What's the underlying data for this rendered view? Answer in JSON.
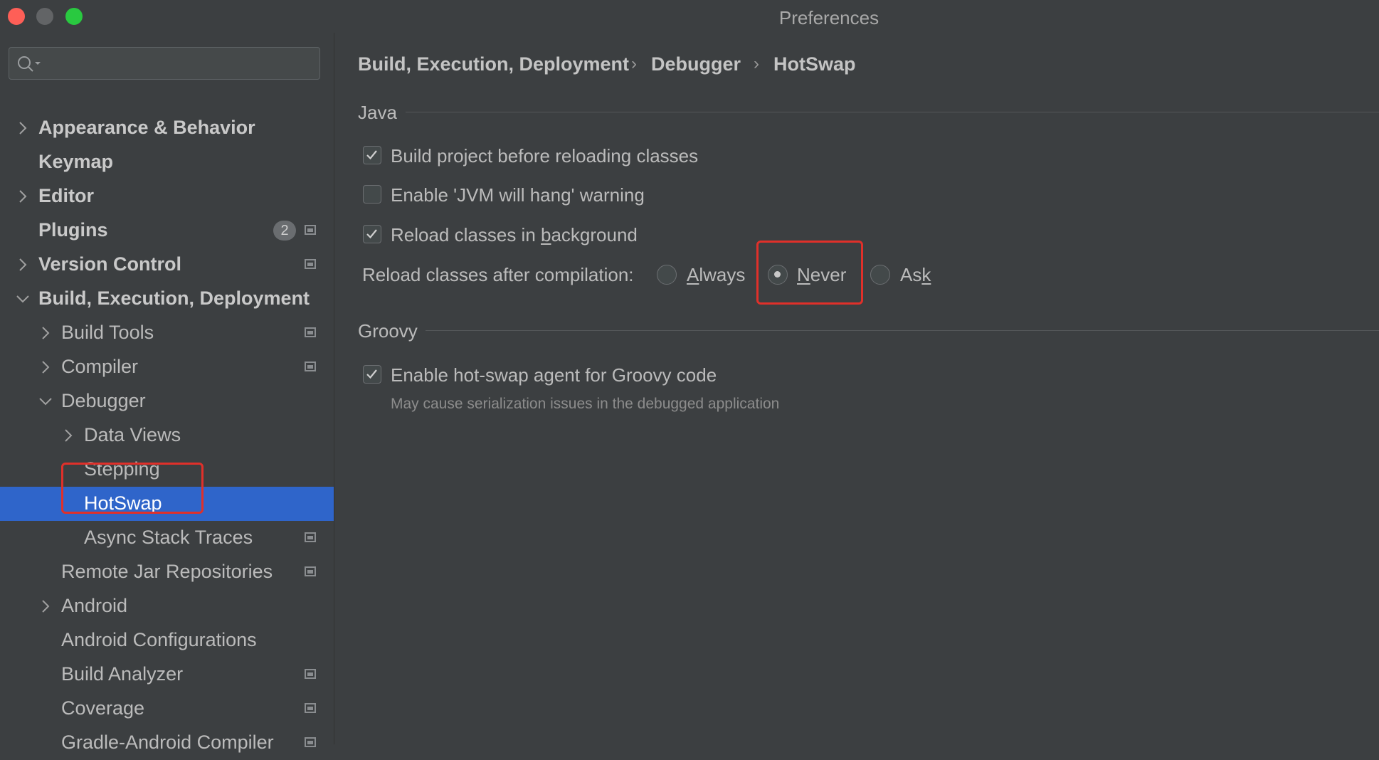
{
  "window": {
    "title": "Preferences"
  },
  "search": {
    "placeholder": ""
  },
  "sidebar": {
    "items": [
      {
        "label": "Appearance & Behavior",
        "bold": true
      },
      {
        "label": "Keymap",
        "bold": true
      },
      {
        "label": "Editor",
        "bold": true
      },
      {
        "label": "Plugins",
        "bold": true,
        "badge": "2"
      },
      {
        "label": "Version Control",
        "bold": true
      },
      {
        "label": "Build, Execution, Deployment",
        "bold": true
      },
      {
        "label": "Build Tools"
      },
      {
        "label": "Compiler"
      },
      {
        "label": "Debugger"
      },
      {
        "label": "Data Views"
      },
      {
        "label": "Stepping"
      },
      {
        "label": "HotSwap",
        "selected": true
      },
      {
        "label": "Async Stack Traces"
      },
      {
        "label": "Remote Jar Repositories"
      },
      {
        "label": "Android"
      },
      {
        "label": "Android Configurations"
      },
      {
        "label": "Build Analyzer"
      },
      {
        "label": "Coverage"
      },
      {
        "label": "Gradle-Android Compiler"
      }
    ]
  },
  "breadcrumb": [
    "Build, Execution, Deployment",
    "Debugger",
    "HotSwap"
  ],
  "java": {
    "title": "Java",
    "options": [
      {
        "label": "Build project before reloading classes",
        "checked": true
      },
      {
        "label": "Enable 'JVM will hang' warning",
        "checked": false
      },
      {
        "label_prefix": "Reload classes in ",
        "label_mnemonic": "b",
        "label_suffix": "ackground",
        "checked": true
      }
    ],
    "reload_label": "Reload classes after compilation:",
    "radios": [
      {
        "mnemonic": "A",
        "rest": "lways",
        "selected": false
      },
      {
        "mnemonic": "N",
        "rest": "ever",
        "selected": true
      },
      {
        "prefix": "As",
        "mnemonic": "k",
        "selected": false
      }
    ]
  },
  "groovy": {
    "title": "Groovy",
    "option": {
      "label": "Enable hot-swap agent for Groovy code",
      "checked": true
    },
    "hint": "May cause serialization issues in the debugged application"
  },
  "colors": {
    "background": "#3c3f41",
    "selection": "#2f65ca",
    "highlight": "#e0302a",
    "text": "#bbbbbb"
  }
}
